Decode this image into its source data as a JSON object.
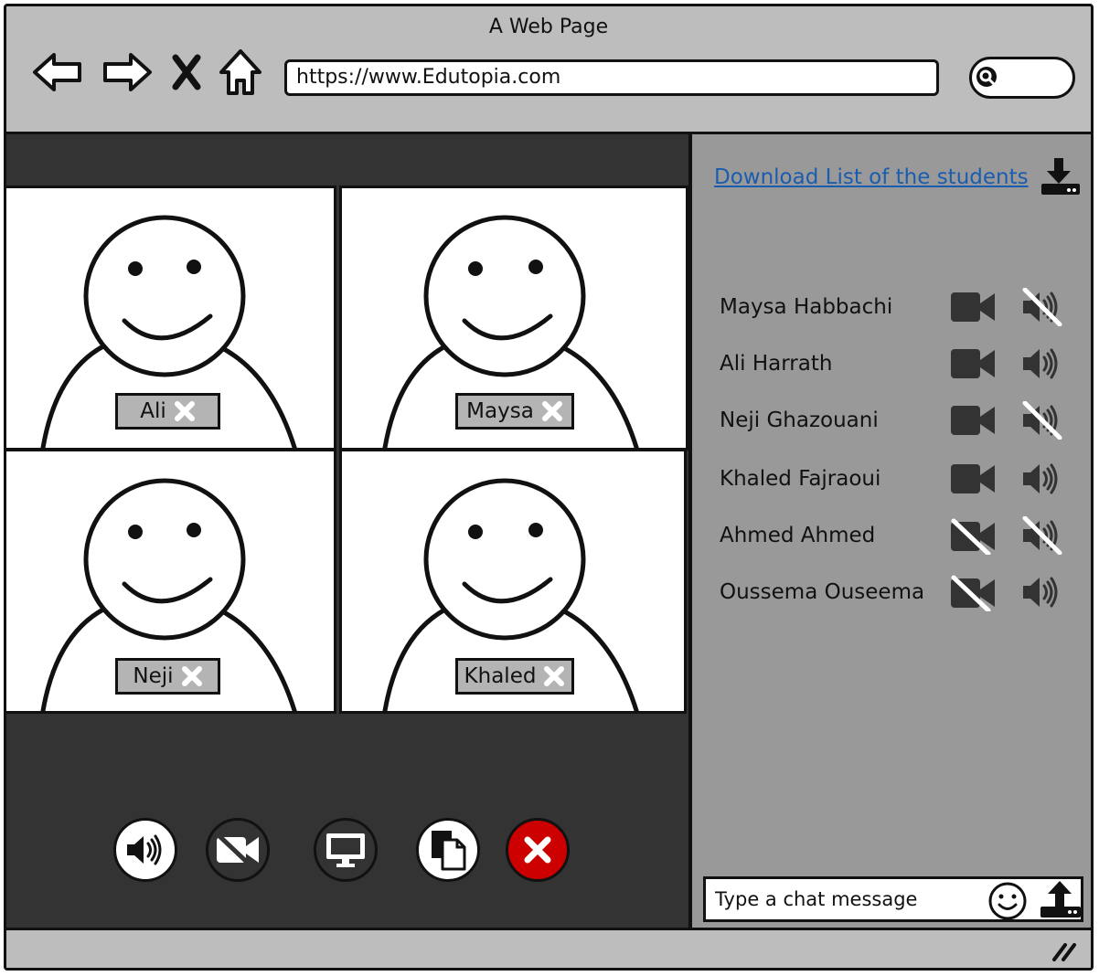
{
  "window": {
    "title": "A Web Page"
  },
  "address_bar": {
    "url": "https://www.Edutopia.com"
  },
  "video_tiles": [
    {
      "name": "Ali"
    },
    {
      "name": "Maysa"
    },
    {
      "name": "Neji"
    },
    {
      "name": "Khaled"
    }
  ],
  "controls": [
    "speaker-icon",
    "video-off-icon",
    "screen-share-icon",
    "copy-icon",
    "end-call-icon"
  ],
  "sidebar": {
    "download_link": "Download List of the students",
    "participants": [
      {
        "name": "Maysa Habbachi",
        "camera": "on",
        "audio": "muted"
      },
      {
        "name": "Ali Harrath",
        "camera": "on",
        "audio": "on"
      },
      {
        "name": "Neji Ghazouani",
        "camera": "on",
        "audio": "muted"
      },
      {
        "name": "Khaled Fajraoui",
        "camera": "on",
        "audio": "on"
      },
      {
        "name": "Ahmed Ahmed",
        "camera": "off",
        "audio": "muted"
      },
      {
        "name": "Oussema Ouseema",
        "camera": "off",
        "audio": "on"
      }
    ],
    "chat_placeholder": "Type a chat message"
  },
  "colors": {
    "end_call": "#cc0000",
    "link": "#1a5cb0",
    "sidebar_bg": "#999999",
    "stage_bg": "#333333"
  }
}
